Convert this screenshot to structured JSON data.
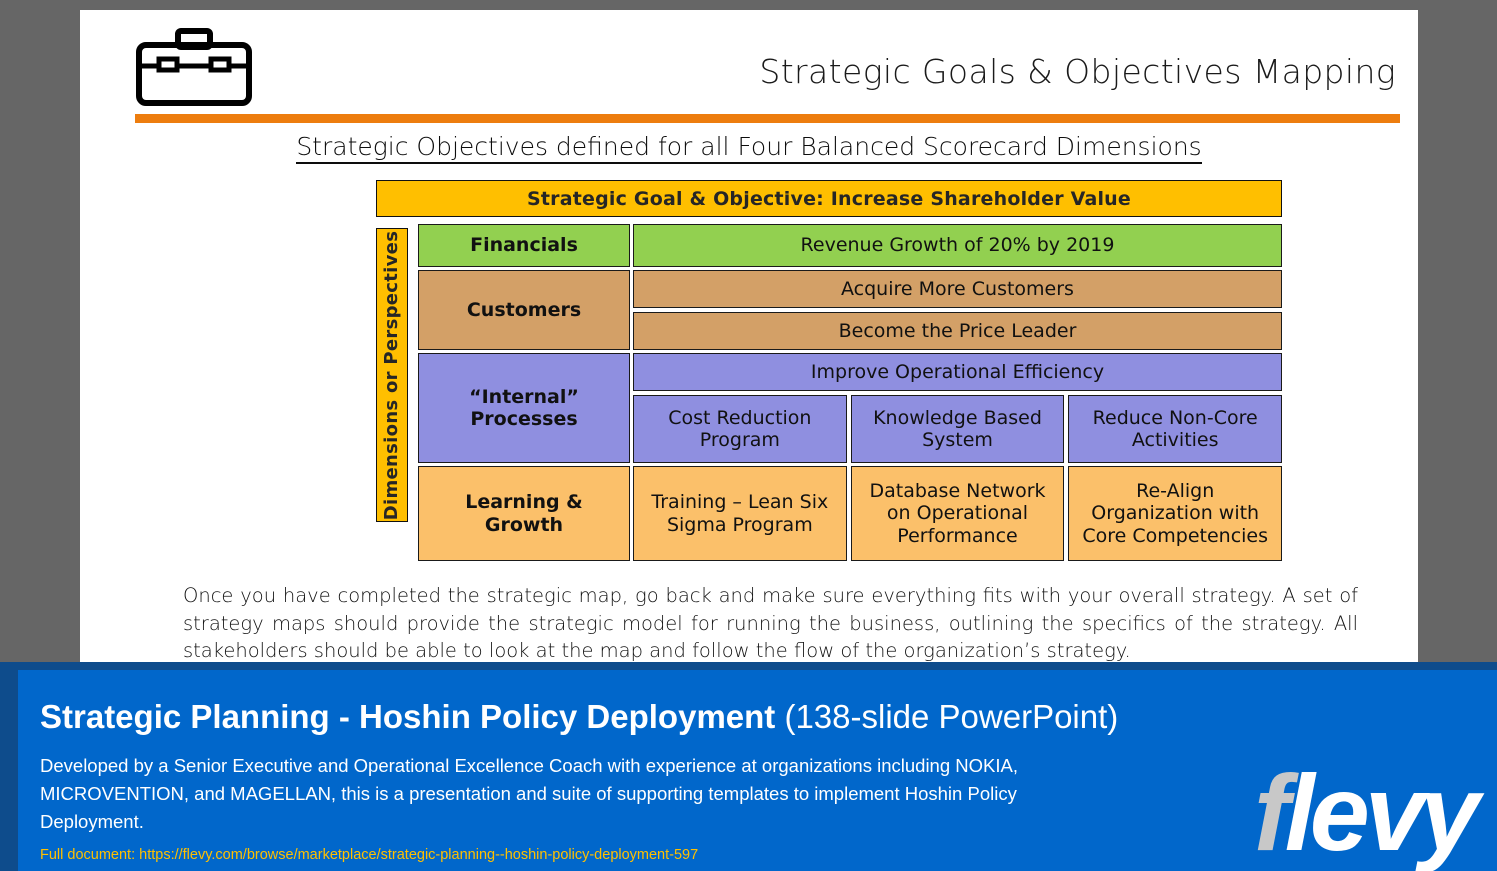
{
  "slide": {
    "header": {
      "icon": "briefcase-icon",
      "title": "Strategic Goals & Objectives Mapping",
      "rule_color": "#ED7D0E"
    },
    "subtitle": "Strategic Objectives defined for all Four Balanced Scorecard Dimensions",
    "matrix": {
      "goal_bar": "Strategic Goal & Objective: Increase Shareholder Value",
      "goal_bar_color": "#FFBF00",
      "vertical_axis_label": "Dimensions or Perspectives",
      "vertical_axis_color": "#FFBF00",
      "rows": [
        {
          "perspective": "Financials",
          "color": "#92D050",
          "objectives_wide": [
            "Revenue Growth of 20% by 2019"
          ],
          "objectives_grid": []
        },
        {
          "perspective": "Customers",
          "color": "#D3A067",
          "objectives_wide": [
            "Acquire More Customers",
            "Become the Price Leader"
          ],
          "objectives_grid": []
        },
        {
          "perspective": "“Internal” Processes",
          "color": "#8F8FE0",
          "objectives_wide": [
            "Improve Operational Efficiency"
          ],
          "objectives_grid": [
            "Cost Reduction Program",
            "Knowledge Based System",
            "Reduce Non-Core Activities"
          ]
        },
        {
          "perspective": "Learning & Growth",
          "color": "#FBC06A",
          "objectives_wide": [],
          "objectives_grid": [
            "Training – Lean Six Sigma Program",
            "Database Network on Operational Performance",
            "Re-Align Organization with Core Competencies"
          ]
        }
      ]
    },
    "body_text": "Once you have completed the strategic map, go back and make sure everything fits with your overall strategy. A set of strategy maps should provide the strategic model for running the business, outlining the specifics of the strategy. All stakeholders should be able to look at the map and follow the flow of the organization’s strategy."
  },
  "footer": {
    "title_bold": "Strategic Planning - Hoshin Policy Deployment",
    "title_light": "(138-slide PowerPoint)",
    "description": "Developed by a Senior Executive and Operational Excellence Coach with experience at organizations including NOKIA, MICROVENTION, and MAGELLAN, this is a presentation and suite of supporting templates to implement Hoshin Policy Deployment.",
    "full_document": "Full document: https://flevy.com/browse/marketplace/strategic-planning--hoshin-policy-deployment-597",
    "logo_first": "f",
    "logo_rest": "levy",
    "bg_color": "#0167CB",
    "border_color": "#0E4C8C",
    "url_color": "#FFC000"
  }
}
